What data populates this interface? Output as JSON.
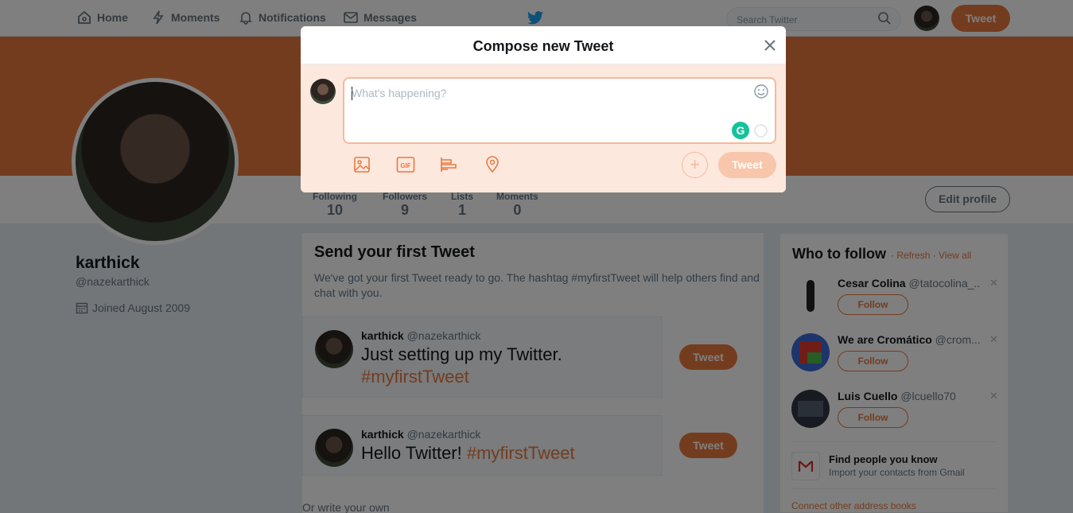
{
  "topnav": {
    "home": "Home",
    "moments": "Moments",
    "notifications": "Notifications",
    "messages": "Messages",
    "search_placeholder": "Search Twitter",
    "tweet_button": "Tweet"
  },
  "colors": {
    "accent": "#e8793e",
    "accent_light": "#f8c6ab"
  },
  "profile": {
    "name": "karthick",
    "handle": "@nazekarthick",
    "joined": "Joined August 2009",
    "stats": [
      {
        "label": "Following",
        "value": "10"
      },
      {
        "label": "Followers",
        "value": "9"
      },
      {
        "label": "Lists",
        "value": "1"
      },
      {
        "label": "Moments",
        "value": "0"
      }
    ],
    "edit_button": "Edit profile"
  },
  "first_tweet": {
    "title": "Send your first Tweet",
    "description": "We've got your first Tweet ready to go. The hashtag #myfirstTweet will help others find and chat with you.",
    "cards": [
      {
        "name": "karthick",
        "handle": "@nazekarthick",
        "text": "Just setting up my Twitter.",
        "hashtag": "#myfirstTweet",
        "button": "Tweet"
      },
      {
        "name": "karthick",
        "handle": "@nazekarthick",
        "text": "Hello Twitter!",
        "hashtag": "#myfirstTweet",
        "button": "Tweet"
      }
    ],
    "or_write": "Or write your own"
  },
  "who_to_follow": {
    "title": "Who to follow",
    "refresh": "Refresh",
    "view_all": "View all",
    "suggestions": [
      {
        "name": "Cesar Colina",
        "handle": "@tatocolina_...",
        "follow": "Follow"
      },
      {
        "name": "We are Cromático",
        "handle": "@crom...",
        "follow": "Follow"
      },
      {
        "name": "Luis Cuello",
        "handle": "@lcuello70",
        "follow": "Follow"
      }
    ],
    "find_title": "Find people you know",
    "find_sub": "Import your contacts from Gmail",
    "connect": "Connect other address books"
  },
  "compose": {
    "title": "Compose new Tweet",
    "placeholder": "What's happening?",
    "grammarly": "G",
    "tweet_button": "Tweet"
  }
}
